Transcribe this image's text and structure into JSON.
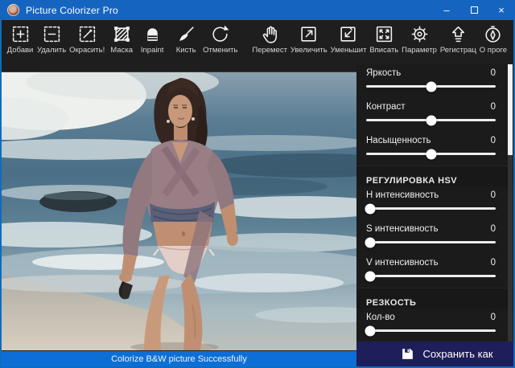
{
  "window": {
    "title": "Picture Colorizer Pro",
    "controls": {
      "minimize": "–",
      "maximize": "",
      "close": "×"
    }
  },
  "colors": {
    "titlebar_blue": "#1565c0",
    "statusbar_blue": "#0d6fd6",
    "save_panel_navy": "#1e1e5a",
    "toolbar_bg": "#1e1e1e",
    "sidebar_bg": "#1b1b1b",
    "window_border_blue": "#0f6cbd"
  },
  "toolbar": {
    "items": [
      {
        "id": "add",
        "label": "Добави"
      },
      {
        "id": "remove",
        "label": "Удалить"
      },
      {
        "id": "colorize",
        "label": "Окрасить!"
      },
      {
        "id": "mask",
        "label": "Маска"
      },
      {
        "id": "inpaint",
        "label": "Inpaint"
      },
      {
        "id": "brush",
        "label": "Кисть"
      },
      {
        "id": "undo",
        "label": "Отменить"
      },
      {
        "id": "move",
        "label": "Перемест"
      },
      {
        "id": "zoom-in",
        "label": "Увеличить"
      },
      {
        "id": "zoom-out",
        "label": "Уменьшит"
      },
      {
        "id": "fit",
        "label": "Вписать"
      },
      {
        "id": "settings",
        "label": "Параметр"
      },
      {
        "id": "register",
        "label": "Регистрац"
      },
      {
        "id": "about",
        "label": "О проге"
      }
    ]
  },
  "statusbar": {
    "message": "Colorize B&W picture Successfully"
  },
  "sidebar": {
    "basic_sliders": [
      {
        "label": "Яркость",
        "value": "0",
        "thumb_percent": 50
      },
      {
        "label": "Контраст",
        "value": "0",
        "thumb_percent": 50
      },
      {
        "label": "Насыщенность",
        "value": "0",
        "thumb_percent": 50
      }
    ],
    "hsv_section": {
      "header": "РЕГУЛИРОВКА HSV",
      "sliders": [
        {
          "label": "H интенсивность",
          "value": "0",
          "thumb_percent": 3
        },
        {
          "label": "S интенсивность",
          "value": "0",
          "thumb_percent": 3
        },
        {
          "label": "V интенсивность",
          "value": "0",
          "thumb_percent": 3
        }
      ]
    },
    "sharpen_section": {
      "header": "РЕЗКОСТЬ",
      "sliders": [
        {
          "label": "Кол-во",
          "value": "0",
          "thumb_percent": 3
        }
      ]
    },
    "save_button": {
      "label": "Сохранить как"
    }
  }
}
